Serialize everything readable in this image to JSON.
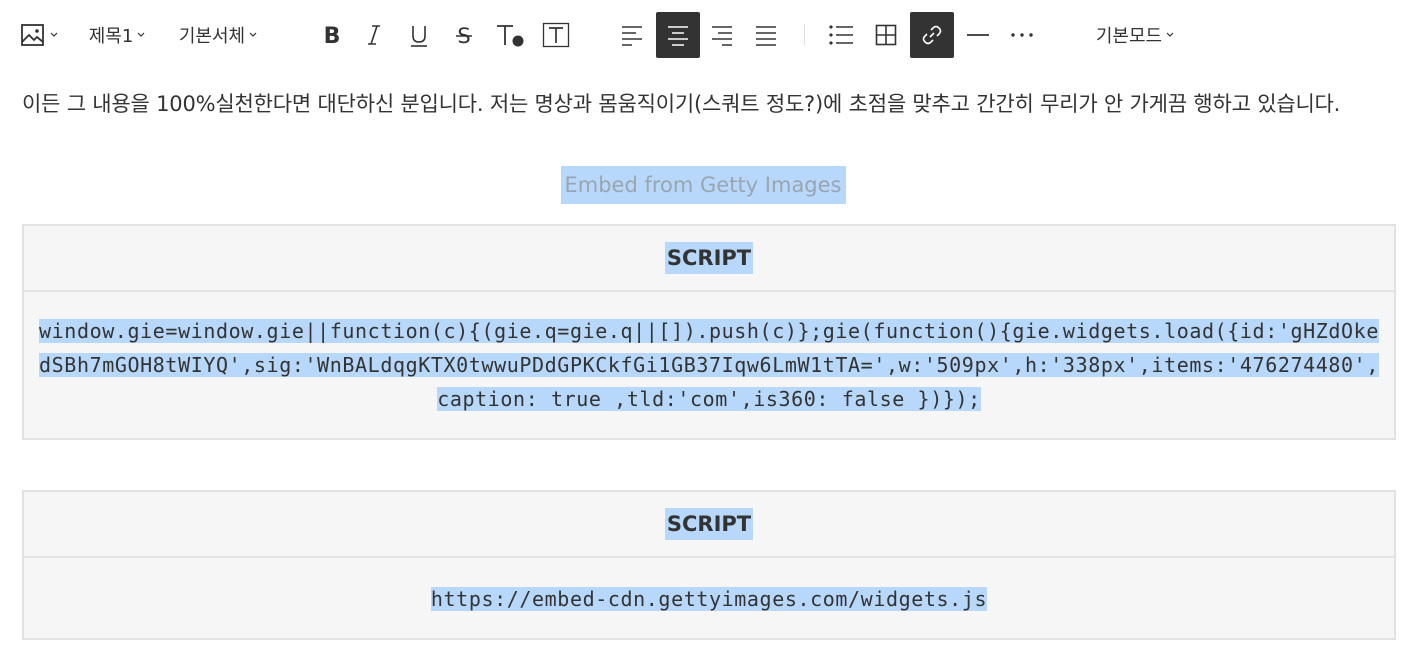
{
  "toolbar": {
    "heading_label": "제목1",
    "font_label": "기본서체",
    "mode_label": "기본모드",
    "active_color": "#333333"
  },
  "content": {
    "paragraph": "이든 그 내용을 100%실천한다면 대단하신 분입니다. 저는 명상과 몸움직이기(스쿼트 정도?)에 초점을 맞추고 간간히 무리가 안 가게끔 행하고 있습니다.",
    "caption": "Embed from Getty Images",
    "blocks": [
      {
        "title": "SCRIPT",
        "code": "window.gie=window.gie||function(c){(gie.q=gie.q||[]).push(c)};gie(function(){gie.widgets.load({id:'gHZdOkedSBh7mGOH8tWIYQ',sig:'WnBALdqgKTX0twwuPDdGPKCkfGi1GB37Iqw6LmW1tTA=',w:'509px',h:'338px',items:'476274480',caption: true ,tld:'com',is360: false })});"
      },
      {
        "title": "SCRIPT",
        "code": "https://embed-cdn.gettyimages.com/widgets.js"
      }
    ]
  },
  "selection_color": "#b7d8fa"
}
